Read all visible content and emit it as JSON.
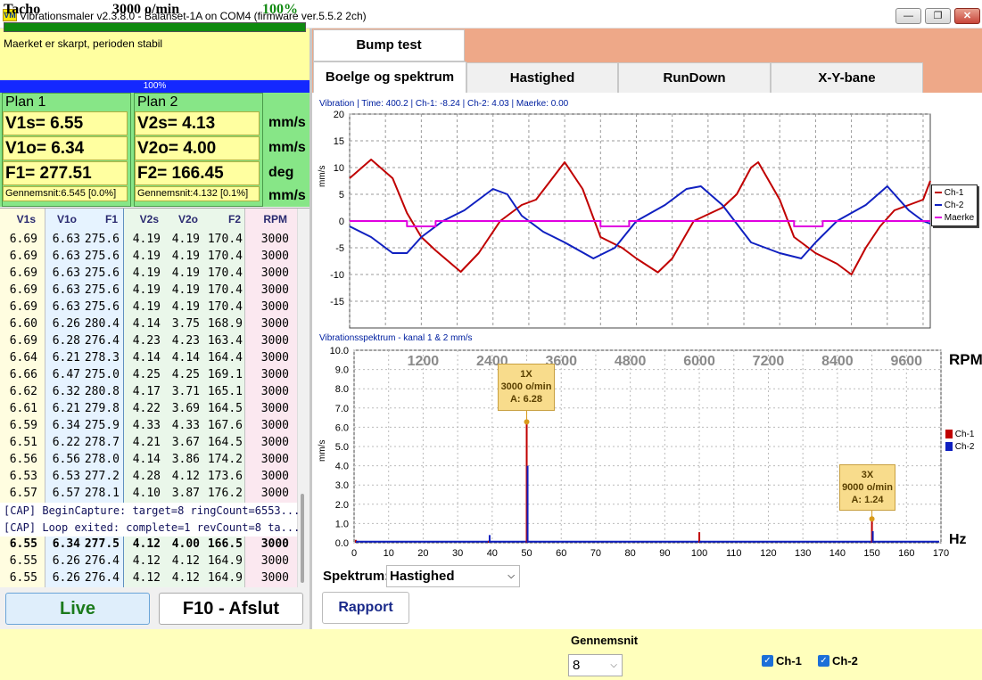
{
  "window": {
    "title": "Vibrationsmaler v2.3.8.0 - Balanset-1A on COM4 (firmware ver.5.5.2 2ch)",
    "icon": "VM",
    "controls": [
      "—",
      "❐",
      "✕"
    ]
  },
  "tacho": {
    "label": "Tacho",
    "rpm": "3000 o/min",
    "percent": "100%",
    "status": "Maerket er skarpt, perioden stabil",
    "progress_label": "100%",
    "progress": 1.0
  },
  "plan1": {
    "title": "Plan 1",
    "v_s": "V1s= 6.55",
    "v_o": "V1o= 6.34",
    "f": "F1= 277.51",
    "avg": "Gennemsnit:6.545 [0.0%]"
  },
  "plan2": {
    "title": "Plan 2",
    "v_s": "V2s= 4.13",
    "v_o": "V2o= 4.00",
    "f": "F2= 166.45",
    "avg": "Gennemsnit:4.132 [0.1%]"
  },
  "units": {
    "u1": "mm/s",
    "u2": "mm/s",
    "u3": "deg",
    "u4": "mm/s"
  },
  "table": {
    "headers": [
      "V1s",
      "V1o",
      "F1",
      "V2s",
      "V2o",
      "F2",
      "RPM"
    ],
    "rows": [
      [
        "6.69",
        "6.63",
        "275.6",
        "4.19",
        "4.19",
        "170.4",
        "3000"
      ],
      [
        "6.69",
        "6.63",
        "275.6",
        "4.19",
        "4.19",
        "170.4",
        "3000"
      ],
      [
        "6.69",
        "6.63",
        "275.6",
        "4.19",
        "4.19",
        "170.4",
        "3000"
      ],
      [
        "6.69",
        "6.63",
        "275.6",
        "4.19",
        "4.19",
        "170.4",
        "3000"
      ],
      [
        "6.69",
        "6.63",
        "275.6",
        "4.19",
        "4.19",
        "170.4",
        "3000"
      ],
      [
        "6.60",
        "6.26",
        "280.4",
        "4.14",
        "3.75",
        "168.9",
        "3000"
      ],
      [
        "6.69",
        "6.28",
        "276.4",
        "4.23",
        "4.23",
        "163.4",
        "3000"
      ],
      [
        "6.64",
        "6.21",
        "278.3",
        "4.14",
        "4.14",
        "164.4",
        "3000"
      ],
      [
        "6.66",
        "6.47",
        "275.0",
        "4.25",
        "4.25",
        "169.1",
        "3000"
      ],
      [
        "6.62",
        "6.32",
        "280.8",
        "4.17",
        "3.71",
        "165.1",
        "3000"
      ],
      [
        "6.61",
        "6.21",
        "279.8",
        "4.22",
        "3.69",
        "164.5",
        "3000"
      ],
      [
        "6.59",
        "6.34",
        "275.9",
        "4.33",
        "4.33",
        "167.6",
        "3000"
      ],
      [
        "6.51",
        "6.22",
        "278.7",
        "4.21",
        "3.67",
        "164.5",
        "3000"
      ],
      [
        "6.56",
        "6.56",
        "278.0",
        "4.14",
        "3.86",
        "174.2",
        "3000"
      ],
      [
        "6.53",
        "6.53",
        "277.2",
        "4.28",
        "4.12",
        "173.6",
        "3000"
      ],
      [
        "6.57",
        "6.57",
        "278.1",
        "4.10",
        "3.87",
        "176.2",
        "3000"
      ]
    ],
    "log": [
      "[CAP] BeginCapture: target=8 ringCount=6553...",
      "[CAP] Loop exited: complete=1 revCount=8 ta..."
    ],
    "rows_after": [
      [
        "6.55",
        "6.34",
        "277.5",
        "4.12",
        "4.00",
        "166.5",
        "3000"
      ],
      [
        "6.55",
        "6.26",
        "276.4",
        "4.12",
        "4.12",
        "164.9",
        "3000"
      ],
      [
        "6.55",
        "6.26",
        "276.4",
        "4.12",
        "4.12",
        "164.9",
        "3000"
      ]
    ]
  },
  "buttons": {
    "live": "Live",
    "exit": "F10 - Afslut",
    "rapport": "Rapport"
  },
  "tabs": {
    "bump": "Bump test",
    "wave": "Boelge og spektrum",
    "speed": "Hastighed",
    "rundown": "RunDown",
    "xy": "X-Y-bane"
  },
  "wave_chart": {
    "header": "Vibration | Time: 400.2 | Ch-1: -8.24 | Ch-2: 4.03 | Maerke: 0.00",
    "ylabel": "mm/s",
    "legend": [
      "Ch-1",
      "Ch-2",
      "Maerke"
    ]
  },
  "spectrum_chart": {
    "header": "Vibrationsspektrum  - kanal 1 & 2 mm/s",
    "ylabel": "mm/s",
    "rpm_label": "RPM",
    "hz_label": "Hz",
    "legend": [
      "Ch-1",
      "Ch-2"
    ],
    "annotation1": {
      "title": "1X",
      "rpm": "3000 o/min",
      "amp": "A: 6.28"
    },
    "annotation2": {
      "title": "3X",
      "rpm": "9000 o/min",
      "amp": "A: 1.24"
    }
  },
  "chart_data": [
    {
      "type": "line",
      "xlim": [
        0,
        810
      ],
      "ylim": [
        -20,
        20
      ],
      "x_ticks": [
        0,
        50,
        100,
        150,
        200,
        250,
        300,
        350,
        400,
        450,
        500,
        550,
        600,
        650,
        700,
        750,
        800
      ],
      "y_ticks": [
        20,
        15,
        10,
        5,
        0,
        -5,
        -10,
        -15
      ],
      "grid": true,
      "legend_position": "right",
      "series": [
        {
          "name": "Ch-1",
          "color": "#c00000",
          "x": [
            0,
            30,
            60,
            80,
            100,
            120,
            155,
            180,
            210,
            240,
            260,
            300,
            325,
            350,
            380,
            400,
            430,
            450,
            480,
            520,
            540,
            560,
            570,
            600,
            620,
            650,
            680,
            700,
            720,
            740,
            760,
            780,
            800,
            810
          ],
          "y": [
            8,
            11.5,
            8,
            1.5,
            -3,
            -5.5,
            -9.5,
            -6,
            0,
            3,
            4,
            11,
            6,
            -3,
            -5,
            -7,
            -9.6,
            -7,
            0,
            2.5,
            5,
            10,
            11,
            4,
            -3,
            -6,
            -8,
            -10,
            -5,
            -1,
            2,
            3,
            4,
            7.5
          ]
        },
        {
          "name": "Ch-2",
          "color": "#1020c0",
          "x": [
            0,
            30,
            60,
            80,
            100,
            130,
            160,
            200,
            220,
            240,
            270,
            300,
            340,
            370,
            400,
            440,
            470,
            490,
            520,
            560,
            600,
            630,
            650,
            680,
            720,
            750,
            780,
            800,
            810
          ],
          "y": [
            -1,
            -3,
            -6,
            -6,
            -3,
            0,
            2,
            6,
            5,
            1,
            -2,
            -4,
            -7,
            -5,
            0,
            3,
            6,
            6.5,
            3,
            -4,
            -6,
            -7,
            -4,
            0,
            3,
            6.5,
            2,
            0,
            -0.5
          ]
        },
        {
          "name": "Maerke",
          "color": "#e000e0",
          "x": [
            0,
            80,
            80,
            120,
            120,
            350,
            350,
            390,
            390,
            620,
            620,
            660,
            660,
            810
          ],
          "y": [
            0,
            0,
            -1,
            -1,
            0,
            0,
            -1,
            -1,
            0,
            0,
            -1,
            -1,
            0,
            0
          ]
        }
      ]
    },
    {
      "type": "bar",
      "xlim": [
        0,
        170
      ],
      "ylim": [
        0,
        10
      ],
      "x_ticks": [
        0,
        10,
        20,
        30,
        40,
        50,
        60,
        70,
        80,
        90,
        100,
        110,
        120,
        130,
        140,
        150,
        160,
        170
      ],
      "y_ticks": [
        10.0,
        9.0,
        8.0,
        7.0,
        6.0,
        5.0,
        4.0,
        3.0,
        2.0,
        1.0,
        0.0
      ],
      "rpm_ticks": [
        1200,
        2400,
        3600,
        4800,
        6000,
        7200,
        8400,
        9600
      ],
      "grid": true,
      "legend_position": "right",
      "series": [
        {
          "name": "Ch-1",
          "color": "#c00000",
          "x": [
            0.5,
            39,
            50,
            100,
            150
          ],
          "values": [
            0.15,
            0.1,
            6.28,
            0.55,
            1.24
          ]
        },
        {
          "name": "Ch-2",
          "color": "#1020c0",
          "x": [
            0.5,
            39,
            50,
            100,
            150
          ],
          "values": [
            0.1,
            0.4,
            4.0,
            0.1,
            0.6
          ]
        }
      ]
    }
  ],
  "spectrum_select": {
    "label": "Spektrum:",
    "value": "Hastighed"
  },
  "bottom": {
    "avg_label": "Gennemsnit",
    "avg_value": "8",
    "ch1": "Ch-1",
    "ch2": "Ch-2"
  }
}
